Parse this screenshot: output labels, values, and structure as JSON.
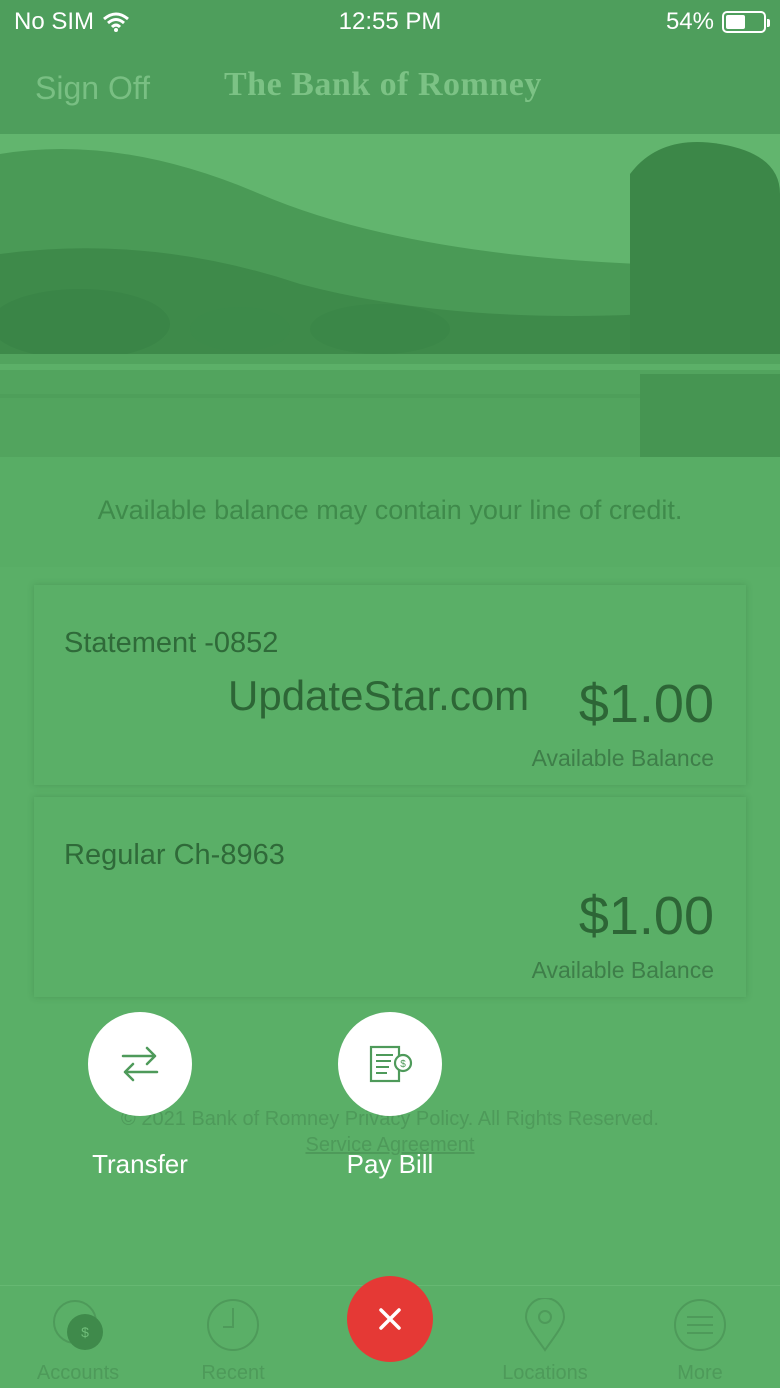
{
  "status": {
    "carrier": "No SIM",
    "time": "12:55 PM",
    "battery": "54%",
    "battery_level": 0.54
  },
  "header": {
    "signoff": "Sign Off",
    "logo": "The Bank of Romney"
  },
  "notice": "Available balance may contain your line of credit.",
  "accounts": [
    {
      "name": "Statement -0852",
      "amount": "$1.00",
      "label": "Available Balance"
    },
    {
      "name": "Regular Ch-8963",
      "amount": "$1.00",
      "label": "Available Balance"
    }
  ],
  "watermark": "UpdateStar.com",
  "footer": {
    "line1": "© 2021 Bank of Romney Privacy Policy. All Rights Reserved.",
    "line2": "Service Agreement"
  },
  "actions": [
    {
      "label": "Transfer",
      "icon": "transfer-icon"
    },
    {
      "label": "Pay Bill",
      "icon": "pay-bill-icon"
    }
  ],
  "tabs": [
    {
      "label": "Accounts",
      "icon": "accounts-icon"
    },
    {
      "label": "Recent",
      "icon": "clock-icon"
    },
    {
      "label": "Locations",
      "icon": "location-pin-icon"
    },
    {
      "label": "More",
      "icon": "menu-icon"
    }
  ],
  "colors": {
    "accent_green": "#5aaf67",
    "close_red": "#e53935"
  }
}
